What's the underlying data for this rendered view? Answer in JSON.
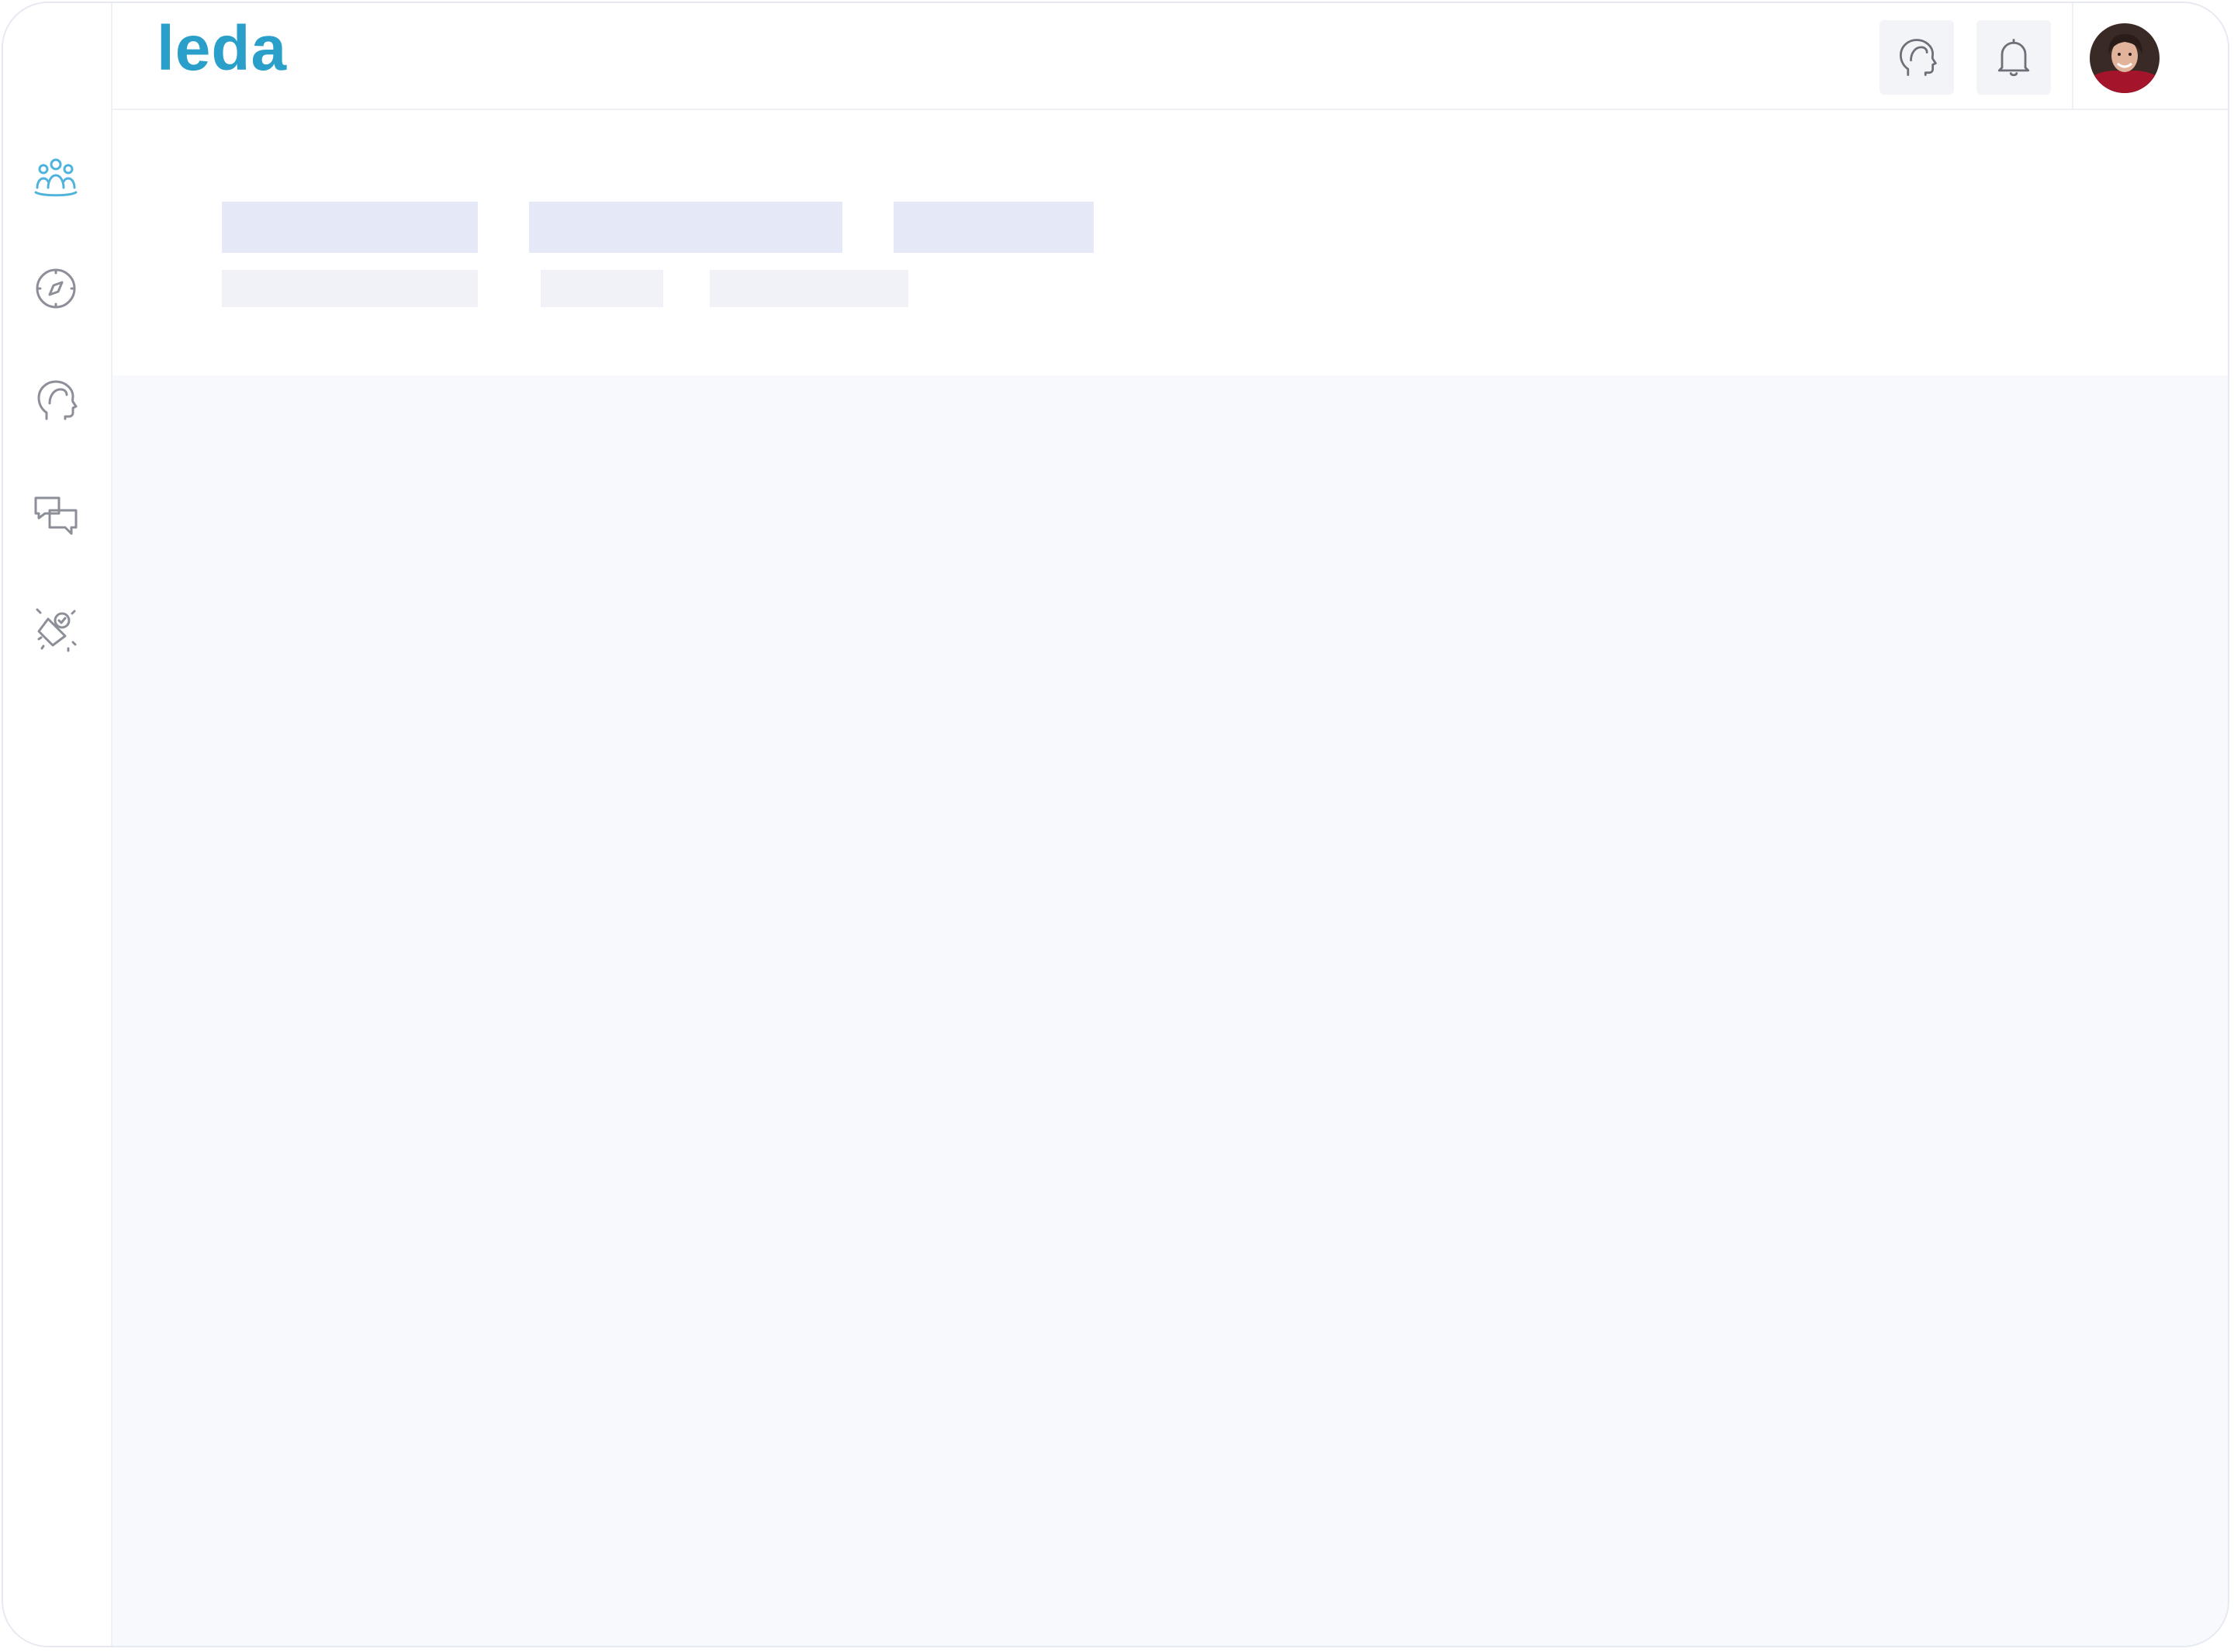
{
  "app": {
    "logo_text": "leda"
  },
  "colors": {
    "brand": "#2a9fc9",
    "icon_active": "#4fb3dc",
    "icon_inactive": "#8d8f98",
    "skeleton_primary": "#e5e8f6",
    "skeleton_secondary": "#f1f2f7",
    "content_bg": "#f7f9fc"
  },
  "sidebar": {
    "items": [
      {
        "icon": "team-icon",
        "active": true
      },
      {
        "icon": "compass-icon",
        "active": false
      },
      {
        "icon": "head-icon",
        "active": false
      },
      {
        "icon": "chat-bubbles-icon",
        "active": false
      },
      {
        "icon": "celebration-badge-icon",
        "active": false
      }
    ]
  },
  "topbar": {
    "actions": [
      {
        "icon": "head-icon"
      },
      {
        "icon": "bell-icon"
      },
      {
        "icon": "avatar"
      }
    ]
  },
  "loading_state": {
    "tabs_placeholders": 3,
    "subtitle_placeholders": 3
  }
}
